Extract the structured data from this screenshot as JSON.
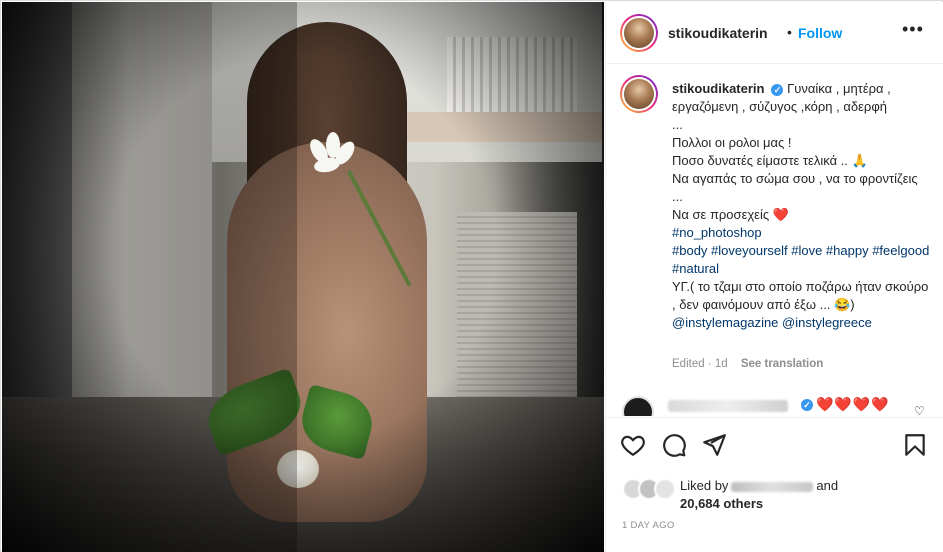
{
  "post": {
    "author": "stikoudikaterin",
    "follow_label": "Follow",
    "more_label": "•••",
    "separator": "•"
  },
  "caption": {
    "author": "stikoudikaterin",
    "lines": [
      "Γυναίκα , μητέρα , εργαζόμενη , σύζυγος ,κόρη , αδερφή",
      "...",
      "Πολλοι οι ρολοι μας !",
      "Ποσο δυνατές είμαστε τελικά .. 🙏",
      "Να αγαπάς το σώμα σου , να το φροντίζεις ...",
      "Να σε προσεχείς ❤️",
      "#no_photoshop",
      "#body #loveyourself #love #happy #feelgood #natural",
      "ΥΓ.( το τζαμι στο οποίο ποζάρω ήταν σκούρο , δεν φαινόμουν από έξω ... 😂)",
      "@instylemagazine @instylegreece"
    ],
    "edited_label": "Edited · 1d",
    "translate_label": "See translation"
  },
  "comment_peek": {
    "hearts": "❤️❤️❤️❤️",
    "like_icon": "♡"
  },
  "actions": {
    "icons": [
      "heart-icon",
      "comment-icon",
      "share-icon",
      "bookmark-icon"
    ]
  },
  "likes": {
    "prefix": "Liked by",
    "suffix": "and",
    "others": "20,684 others"
  },
  "time_ago": "1 DAY AGO",
  "colors": {
    "accent_blue": "#0095f6",
    "verified_blue": "#3897f0",
    "hashtag": "#00376b",
    "heart_red": "#ed1c24",
    "muted": "#8e8e8e"
  }
}
